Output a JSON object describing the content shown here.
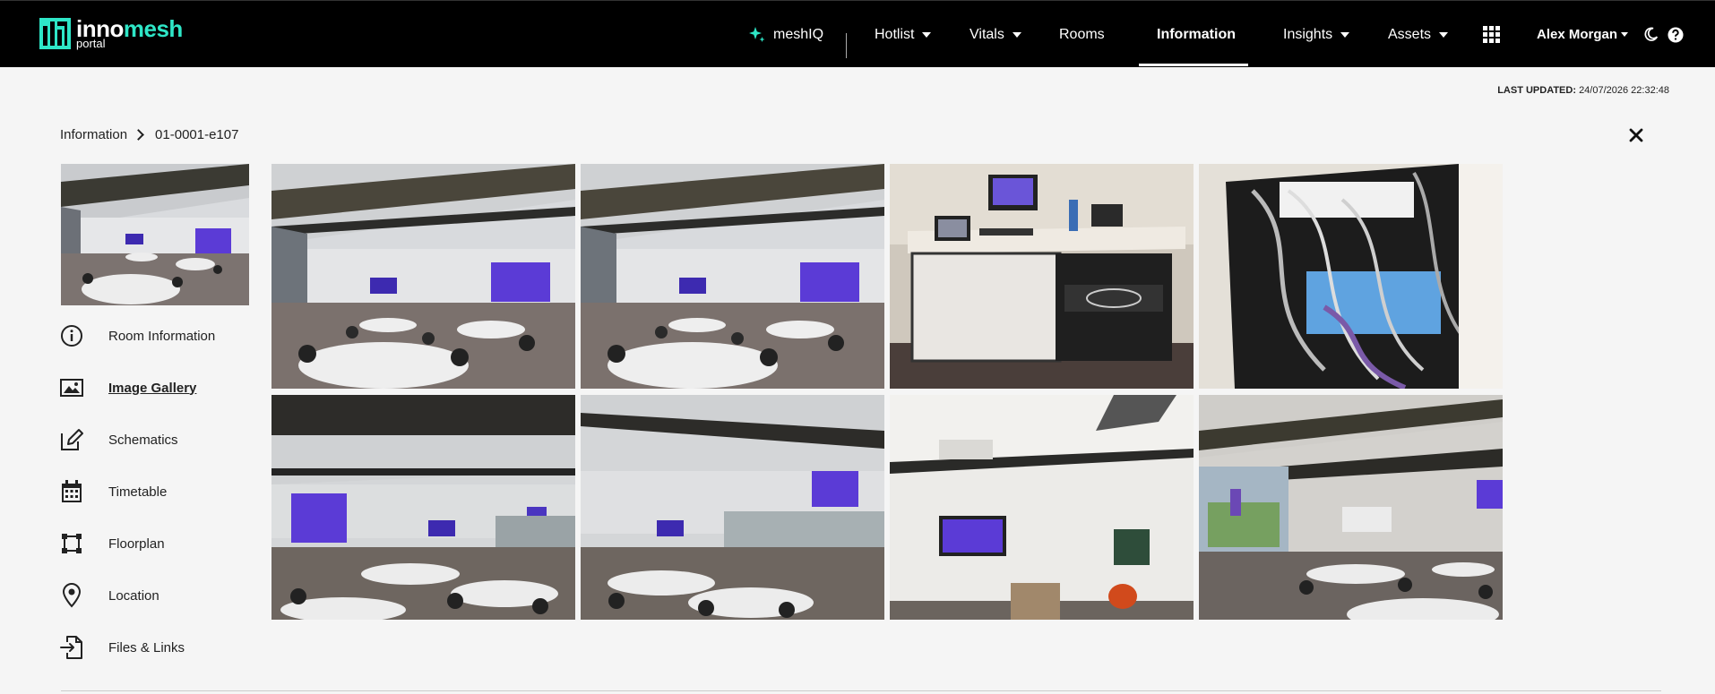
{
  "brand": {
    "name_part1": "inno",
    "name_part2": "mesh",
    "sub": "portal"
  },
  "nav": {
    "meshiq": "meshIQ",
    "hotlist": "Hotlist",
    "vitals": "Vitals",
    "rooms": "Rooms",
    "information": "Information",
    "insights": "Insights",
    "assets": "Assets",
    "user": "Alex Morgan"
  },
  "status": {
    "last_updated_label": "LAST UPDATED:",
    "last_updated_value": "24/07/2026 22:32:48"
  },
  "breadcrumb": {
    "root": "Information",
    "current": "01-0001-e107"
  },
  "sidebar": {
    "items": [
      {
        "label": "Room Information",
        "icon": "info-icon"
      },
      {
        "label": "Image Gallery",
        "icon": "image-icon"
      },
      {
        "label": "Schematics",
        "icon": "edit-icon"
      },
      {
        "label": "Timetable",
        "icon": "calendar-icon"
      },
      {
        "label": "Floorplan",
        "icon": "floorplan-icon"
      },
      {
        "label": "Location",
        "icon": "location-pin-icon"
      },
      {
        "label": "Files & Links",
        "icon": "file-import-icon"
      }
    ],
    "active_item": "Image Gallery"
  },
  "colors": {
    "accent": "#2ee6c7",
    "nav_bg": "#000000",
    "page_bg": "#f5f5f5",
    "screen_purple": "#5b3bd6"
  },
  "gallery": {
    "photos": [
      {
        "subject": "classroom-wide-view"
      },
      {
        "subject": "classroom-wide-view"
      },
      {
        "subject": "lectern-desk"
      },
      {
        "subject": "cabling-rack"
      },
      {
        "subject": "classroom-view-left"
      },
      {
        "subject": "classroom-view-right"
      },
      {
        "subject": "front-wall-display"
      },
      {
        "subject": "projection-screen-view"
      }
    ]
  }
}
